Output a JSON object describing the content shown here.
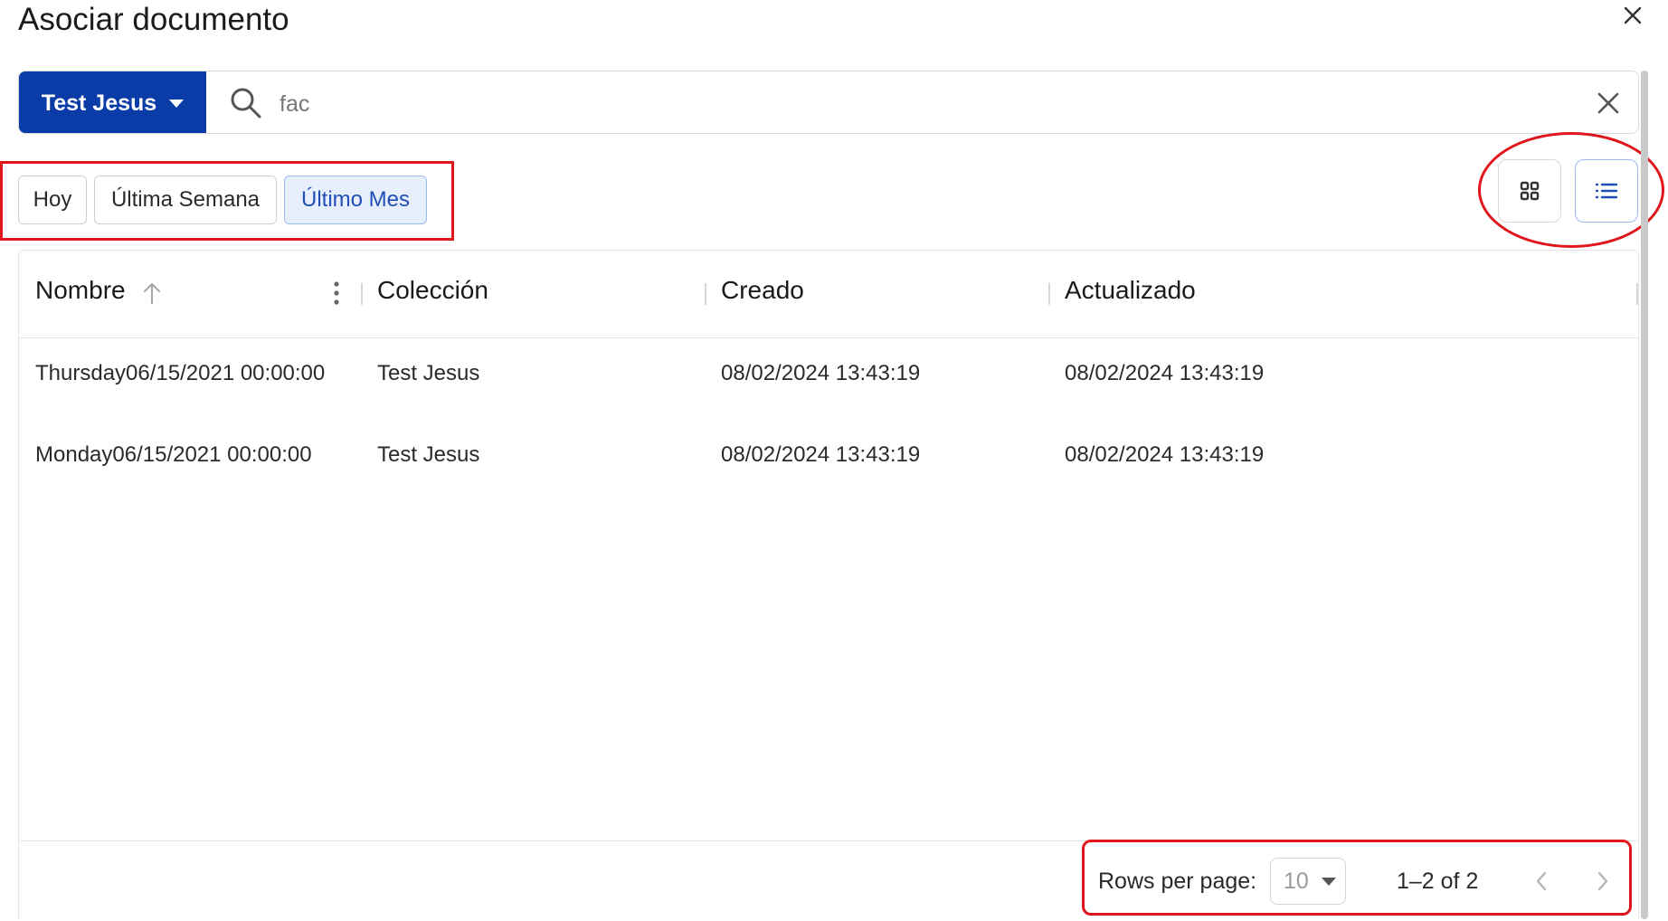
{
  "dialog": {
    "title": "Asociar documento"
  },
  "search": {
    "collection": "Test Jesus",
    "query": "fac"
  },
  "filters": [
    {
      "label": "Hoy",
      "selected": false
    },
    {
      "label": "Última Semana",
      "selected": false
    },
    {
      "label": "Último Mes",
      "selected": true
    }
  ],
  "view": {
    "active": "list",
    "options": [
      "grid",
      "list"
    ]
  },
  "table": {
    "columns": [
      "Nombre",
      "Colección",
      "Creado",
      "Actualizado"
    ],
    "sort": {
      "column": "Nombre",
      "direction": "asc"
    },
    "rows": [
      {
        "nombre": "Thursday06/15/2021 00:00:00",
        "coleccion": "Test Jesus",
        "creado": "08/02/2024 13:43:19",
        "actualizado": "08/02/2024 13:43:19"
      },
      {
        "nombre": "Monday06/15/2021 00:00:00",
        "coleccion": "Test Jesus",
        "creado": "08/02/2024 13:43:19",
        "actualizado": "08/02/2024 13:43:19"
      }
    ]
  },
  "pagination": {
    "rows_label": "Rows per page:",
    "rows_per_page": "10",
    "range": "1–2 of 2"
  },
  "colors": {
    "primary": "#0a3ca8",
    "selected_bg": "#e8effc",
    "selected_text": "#1f4fb6",
    "highlight": "#e0161c"
  },
  "icons": [
    "close-icon",
    "caret-down-icon",
    "search-icon",
    "clear-icon",
    "grid-icon",
    "list-icon",
    "sort-asc-icon",
    "more-vert-icon",
    "chevron-left-icon",
    "chevron-right-icon"
  ]
}
